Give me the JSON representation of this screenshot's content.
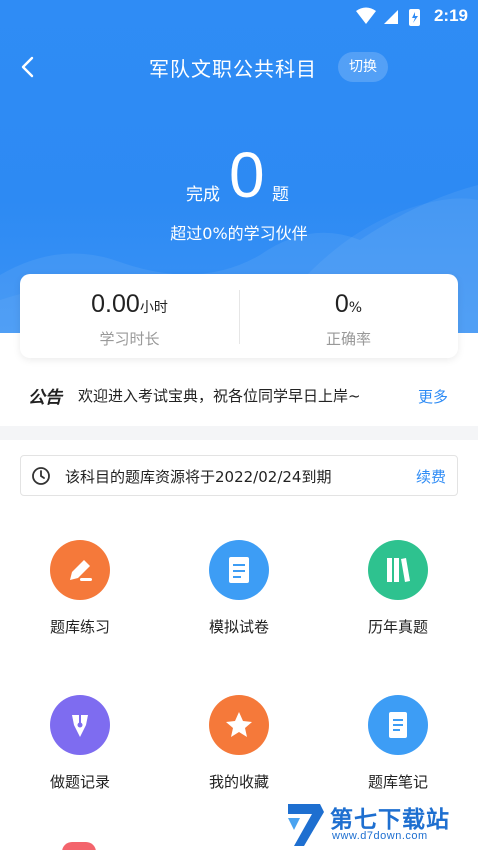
{
  "status_bar": {
    "time": "2:19"
  },
  "nav": {
    "title": "军队文职公共科目",
    "switch_label": "切换"
  },
  "progress": {
    "prefix": "完成",
    "count": "0",
    "suffix": "题",
    "beat_text": "超过0%的学习伙伴"
  },
  "stats": {
    "study_time": {
      "value": "0.00",
      "unit": "小时",
      "label": "学习时长"
    },
    "accuracy": {
      "value": "0",
      "unit": "%",
      "label": "正确率"
    }
  },
  "notice": {
    "tag": "公告",
    "text": "欢迎进入考试宝典，祝各位同学早日上岸~",
    "more": "更多"
  },
  "expire": {
    "text": "该科目的题库资源将于2022/02/24到期",
    "renew": "续费"
  },
  "grid": [
    {
      "label": "题库练习",
      "icon": "pencil-edit-icon",
      "color": "#f5793a"
    },
    {
      "label": "模拟试卷",
      "icon": "test-paper-icon",
      "color": "#3d9df5"
    },
    {
      "label": "历年真题",
      "icon": "books-icon",
      "color": "#2ec28f"
    },
    {
      "label": "做题记录",
      "icon": "pen-nib-icon",
      "color": "#7e6cf0"
    },
    {
      "label": "我的收藏",
      "icon": "star-icon",
      "color": "#f5793a"
    },
    {
      "label": "题库笔记",
      "icon": "note-icon",
      "color": "#3d9df5"
    }
  ],
  "watermark": {
    "title": "第七下载站",
    "url": "www.d7down.com"
  },
  "colors": {
    "primary": "#2f8cf5",
    "background": "#ffffff",
    "band": "#f4f5f7"
  }
}
